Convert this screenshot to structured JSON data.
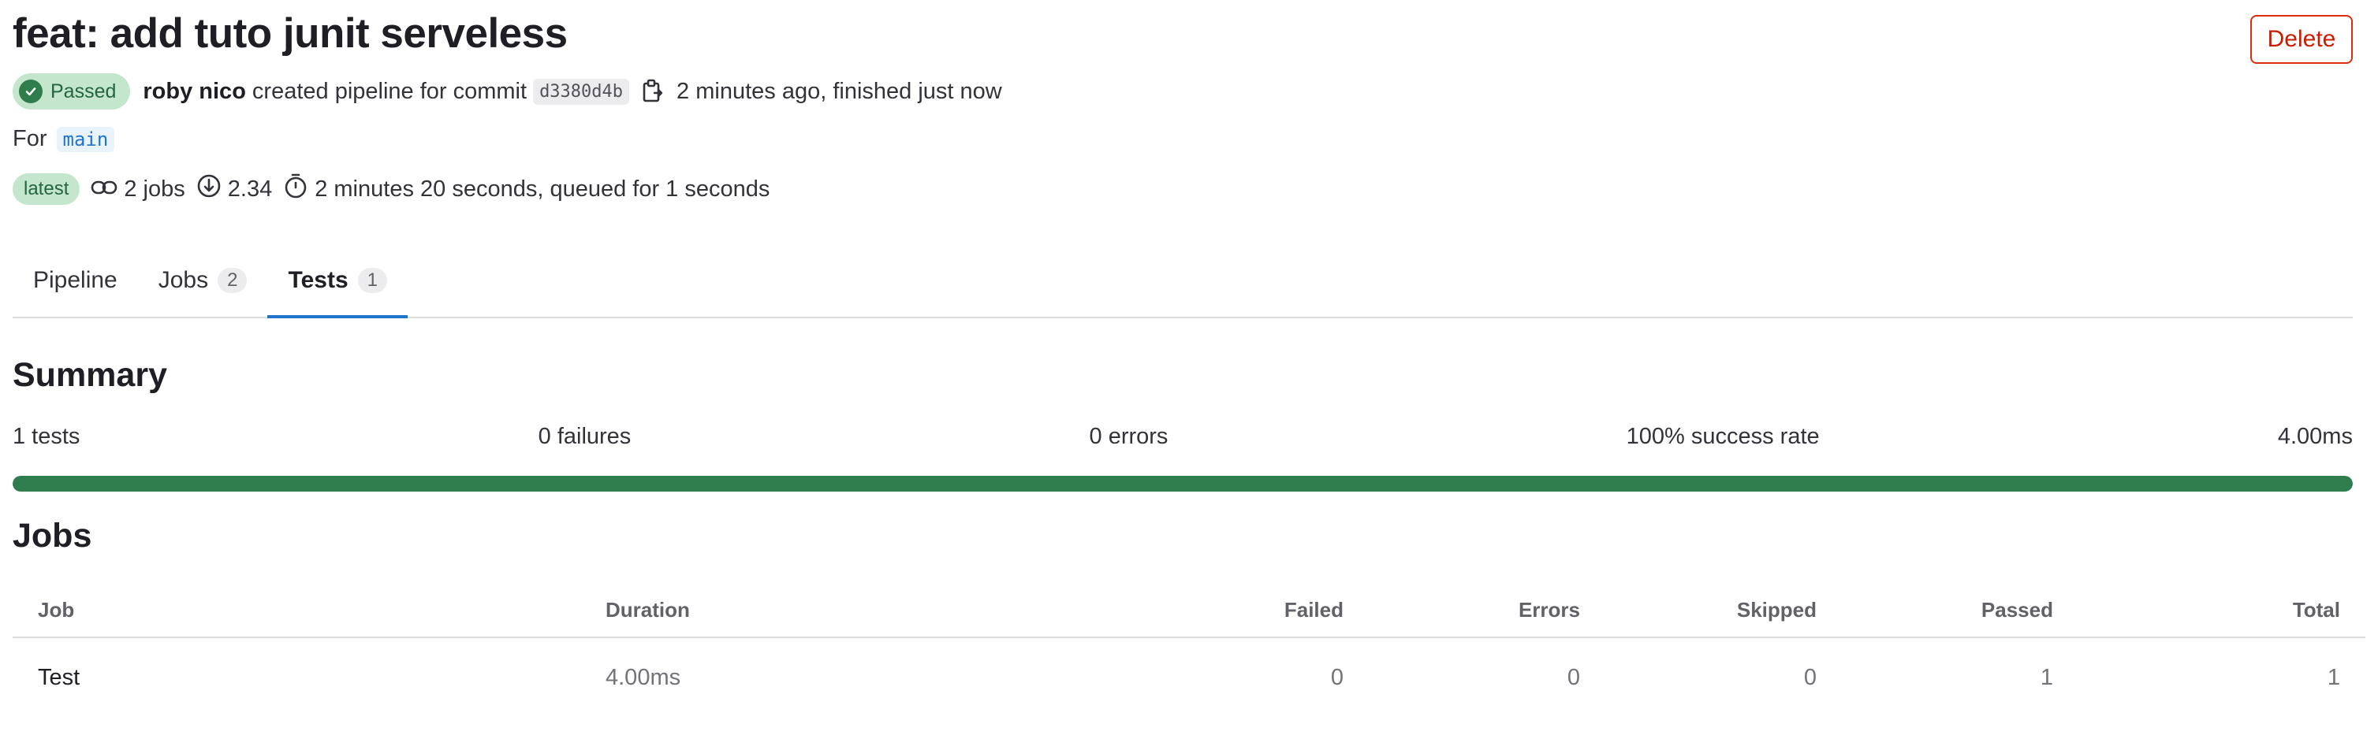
{
  "header": {
    "title": "feat: add tuto junit serveless",
    "delete_label": "Delete"
  },
  "pipeline": {
    "status": "Passed",
    "author": "roby nico",
    "action_text": "created pipeline for commit",
    "commit_sha": "d3380d4b",
    "time_text": "2 minutes ago, finished just now",
    "ref_prefix": "For",
    "ref_name": "main",
    "latest_label": "latest",
    "jobs_count_text": "2 jobs",
    "compute_text": "2.34",
    "duration_text": "2 minutes 20 seconds, queued for 1 seconds"
  },
  "tabs": [
    {
      "label": "Pipeline",
      "count": null,
      "active": false
    },
    {
      "label": "Jobs",
      "count": "2",
      "active": false
    },
    {
      "label": "Tests",
      "count": "1",
      "active": true
    }
  ],
  "summary": {
    "title": "Summary",
    "tests": "1 tests",
    "failures": "0 failures",
    "errors": "0 errors",
    "success_rate": "100% success rate",
    "duration": "4.00ms",
    "success_fraction": 1.0
  },
  "jobs": {
    "title": "Jobs",
    "columns": [
      "Job",
      "Duration",
      "Failed",
      "Errors",
      "Skipped",
      "Passed",
      "Total"
    ],
    "rows": [
      {
        "job": "Test",
        "duration": "4.00ms",
        "failed": "0",
        "errors": "0",
        "skipped": "0",
        "passed": "1",
        "total": "1"
      }
    ]
  },
  "colors": {
    "success": "#2f7d4d",
    "danger": "#dd2b0e",
    "link": "#1f75cb"
  },
  "icons": {
    "status": "check-circle-icon",
    "copy": "copy-icon",
    "jobs": "link-icon",
    "compute": "compute-icon",
    "duration": "timer-icon"
  }
}
